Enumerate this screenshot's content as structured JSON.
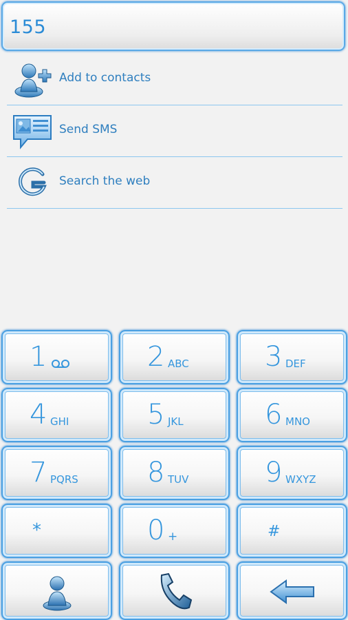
{
  "display": {
    "number": "155"
  },
  "suggestions": [
    {
      "label": "Add to contacts",
      "icon": "add-contact-icon"
    },
    {
      "label": "Send SMS",
      "icon": "sms-icon"
    },
    {
      "label": "Search the web",
      "icon": "google-search-icon"
    }
  ],
  "keys": {
    "k1": {
      "digit": "1",
      "letters": "",
      "icon": "voicemail-icon"
    },
    "k2": {
      "digit": "2",
      "letters": "ABC"
    },
    "k3": {
      "digit": "3",
      "letters": "DEF"
    },
    "k4": {
      "digit": "4",
      "letters": "GHI"
    },
    "k5": {
      "digit": "5",
      "letters": "JKL"
    },
    "k6": {
      "digit": "6",
      "letters": "MNO"
    },
    "k7": {
      "digit": "7",
      "letters": "PQRS"
    },
    "k8": {
      "digit": "8",
      "letters": "TUV"
    },
    "k9": {
      "digit": "9",
      "letters": "WXYZ"
    },
    "kstar": {
      "digit": "*"
    },
    "k0": {
      "digit": "0",
      "letters": "+"
    },
    "khash": {
      "digit": "#"
    }
  },
  "bottom_bar": {
    "contacts": "contacts-icon",
    "call": "phone-icon",
    "backspace": "backspace-icon"
  },
  "colors": {
    "accent": "#3596dd",
    "border": "#4aa0e2",
    "background": "#f2f2f2"
  }
}
